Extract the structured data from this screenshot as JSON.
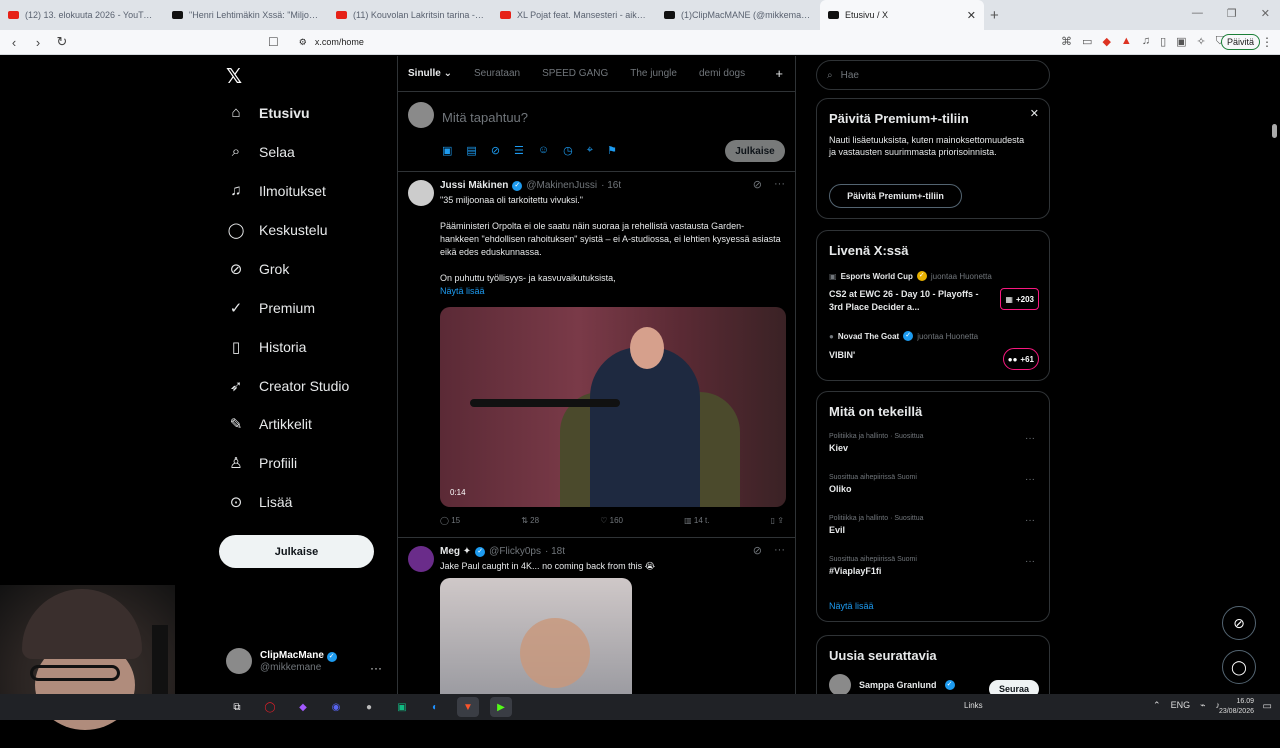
{
  "browser": {
    "tabs": [
      {
        "title": "(12) 13. elokuuta 2026 - YouTube",
        "color": "#e62117"
      },
      {
        "title": "\"Henri Lehtimäkin Xssä: \"Miljoonia Su",
        "color": "#111111"
      },
      {
        "title": "(11) Kouvolan Lakritsin tarina - Tämä",
        "color": "#e62117"
      },
      {
        "title": "XL Pojat feat. Mansesteri - aika Pakkas",
        "color": "#e62117"
      },
      {
        "title": "(1)ClipMacMANE (@mikkemane) | T",
        "color": "#111111"
      },
      {
        "title": "Etusivu / X",
        "color": "#111111"
      }
    ],
    "url": "x.com/home",
    "update_label": "Päivitä"
  },
  "nav": {
    "items": [
      {
        "label": "Etusivu",
        "icon": "home-icon"
      },
      {
        "label": "Selaa",
        "icon": "search-icon"
      },
      {
        "label": "Ilmoitukset",
        "icon": "bell-icon"
      },
      {
        "label": "Keskustelu",
        "icon": "chat-icon"
      },
      {
        "label": "Grok",
        "icon": "grok-icon"
      },
      {
        "label": "Premium",
        "icon": "premium-icon"
      },
      {
        "label": "Historia",
        "icon": "bookmark-icon"
      },
      {
        "label": "Creator Studio",
        "icon": "rocket-icon"
      },
      {
        "label": "Artikkelit",
        "icon": "article-icon"
      },
      {
        "label": "Profiili",
        "icon": "person-icon"
      },
      {
        "label": "Lisää",
        "icon": "more-icon"
      }
    ],
    "post_label": "Julkaise",
    "profile": {
      "name": "ClipMacMane",
      "handle": "@mikkemane"
    }
  },
  "feed": {
    "tabs": [
      "Sinulle",
      "Seurataan",
      "SPEED GANG",
      "The jungle",
      "demi dogs"
    ],
    "compose_placeholder": "Mitä tapahtuu?",
    "compose_button": "Julkaise",
    "tweets": [
      {
        "name": "Jussi Mäkinen",
        "handle": "@MakinenJussi",
        "time": "· 16t",
        "text": "\"35 miljoonaa oli tarkoitettu vivuksi.\"\n\nPääministeri Orpolta ei ole saatu näin suoraa ja rehellistä vastausta Garden-hankkeen \"ehdollisen rahoituksen\" syistä – ei A-studiossa, ei lehtien kysyessä asiasta eikä edes eduskunnassa.\n\nOn puhuttu työllisyys- ja kasvuvaikutuksista,",
        "more": "Näytä lisää",
        "duration": "0:14",
        "replies": "15",
        "retweets": "28",
        "likes": "160",
        "views": "14 t."
      },
      {
        "name": "Meg ✦",
        "handle": "@Flicky0ps",
        "time": "· 18t",
        "text": "Jake Paul caught in 4K... no coming back from this 😭"
      }
    ]
  },
  "right": {
    "search_placeholder": "Hae",
    "premium": {
      "title": "Päivitä Premium+-tiliin",
      "desc": "Nauti lisäetuuksista, kuten mainoksettomuudesta ja vastausten suurimmasta priorisoinnista.",
      "button": "Päivitä Premium+-tiliin"
    },
    "live": {
      "title": "Livenä X:ssä",
      "items": [
        {
          "host": "Esports World Cup",
          "action": "juontaa Huonetta",
          "title": "CS2 at EWC 26 - Day 10 - Playoffs - 3rd Place Decider a...",
          "count": "+203"
        },
        {
          "host": "Novad The Goat",
          "action": "juontaa Huonetta",
          "title": "VIBIN'",
          "count": "+61"
        }
      ]
    },
    "trends": {
      "title": "Mitä on tekeillä",
      "items": [
        {
          "category": "Politiikka ja hallinto · Suosittua",
          "name": "Kiev"
        },
        {
          "category": "Suosittua aihepiirissä Suomi",
          "name": "Oliko"
        },
        {
          "category": "Politiikka ja hallinto · Suosittua",
          "name": "Evil"
        },
        {
          "category": "Suosittua aihepiirissä Suomi",
          "name": "#ViaplayF1fi"
        }
      ],
      "show_more": "Näytä lisää"
    },
    "who_to_follow": {
      "title": "Uusia seurattavia",
      "name": "Samppa Granlund",
      "button": "Seuraa"
    }
  },
  "taskbar": {
    "links": "Links",
    "lang": "ENG",
    "time": "16.09",
    "date": "23/08/2026"
  }
}
